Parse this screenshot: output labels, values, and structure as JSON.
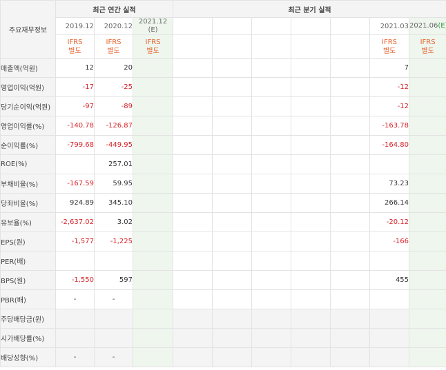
{
  "header": {
    "side_label": "주요재무정보",
    "annual_group": "최근 연간 실적",
    "quarter_group": "최근 분기 실적"
  },
  "annual_columns": [
    {
      "date": "2019.12",
      "basis": "IFRS",
      "basis2": "별도"
    },
    {
      "date": "2020.12",
      "basis": "IFRS",
      "basis2": "별도"
    },
    {
      "date": "2021.12",
      "est": "(E)",
      "basis": "IFRS",
      "basis2": "별도"
    }
  ],
  "quarter_columns": [
    {
      "date": "2021.03",
      "basis": "IFRS",
      "basis2": "별도"
    },
    {
      "date": "2021.06",
      "est": "(E)",
      "basis": "IFRS",
      "basis2": "별도"
    }
  ],
  "rows": [
    {
      "label": "매출액(억원)",
      "a": [
        "12",
        "20",
        ""
      ],
      "q": [
        "7",
        ""
      ]
    },
    {
      "label": "영업이익(억원)",
      "a": [
        "-17",
        "-25",
        ""
      ],
      "q": [
        "-12",
        ""
      ]
    },
    {
      "label": "당기순이익(억원)",
      "a": [
        "-97",
        "-89",
        ""
      ],
      "q": [
        "-12",
        ""
      ]
    },
    {
      "label": "영업이익률(%)",
      "a": [
        "-140.78",
        "-126.87",
        ""
      ],
      "q": [
        "-163.78",
        ""
      ]
    },
    {
      "label": "순이익률(%)",
      "a": [
        "-799.68",
        "-449.95",
        ""
      ],
      "q": [
        "-164.80",
        ""
      ]
    },
    {
      "label": "ROE(%)",
      "a": [
        "",
        "257.01",
        ""
      ],
      "q": [
        "",
        ""
      ]
    },
    {
      "label": "부채비율(%)",
      "a": [
        "-167.59",
        "59.95",
        ""
      ],
      "q": [
        "73.23",
        ""
      ]
    },
    {
      "label": "당좌비율(%)",
      "a": [
        "924.89",
        "345.10",
        ""
      ],
      "q": [
        "266.14",
        ""
      ]
    },
    {
      "label": "유보율(%)",
      "a": [
        "-2,637.02",
        "3.02",
        ""
      ],
      "q": [
        "-20.12",
        ""
      ]
    },
    {
      "label": "EPS(원)",
      "a": [
        "-1,577",
        "-1,225",
        ""
      ],
      "q": [
        "-166",
        ""
      ]
    },
    {
      "label": "PER(배)",
      "a": [
        "",
        "",
        ""
      ],
      "q": [
        "",
        ""
      ]
    },
    {
      "label": "BPS(원)",
      "a": [
        "-1,550",
        "597",
        ""
      ],
      "q": [
        "455",
        ""
      ]
    },
    {
      "label": "PBR(배)",
      "a": [
        "-",
        "-",
        ""
      ],
      "q": [
        "",
        ""
      ]
    },
    {
      "label": "주당배당금(원)",
      "a": [
        "",
        "",
        ""
      ],
      "q": [
        "",
        ""
      ]
    },
    {
      "label": "시가배당률(%)",
      "a": [
        "",
        "",
        ""
      ],
      "q": [
        "",
        ""
      ]
    },
    {
      "label": "배당성향(%)",
      "a": [
        "-",
        "-",
        ""
      ],
      "q": [
        "",
        ""
      ]
    }
  ],
  "colors": {
    "negative": "#d8232a",
    "ifrs": "#e8602a",
    "estimate_bg": "#eef6ee",
    "header_bg": "#f4f4f4"
  }
}
